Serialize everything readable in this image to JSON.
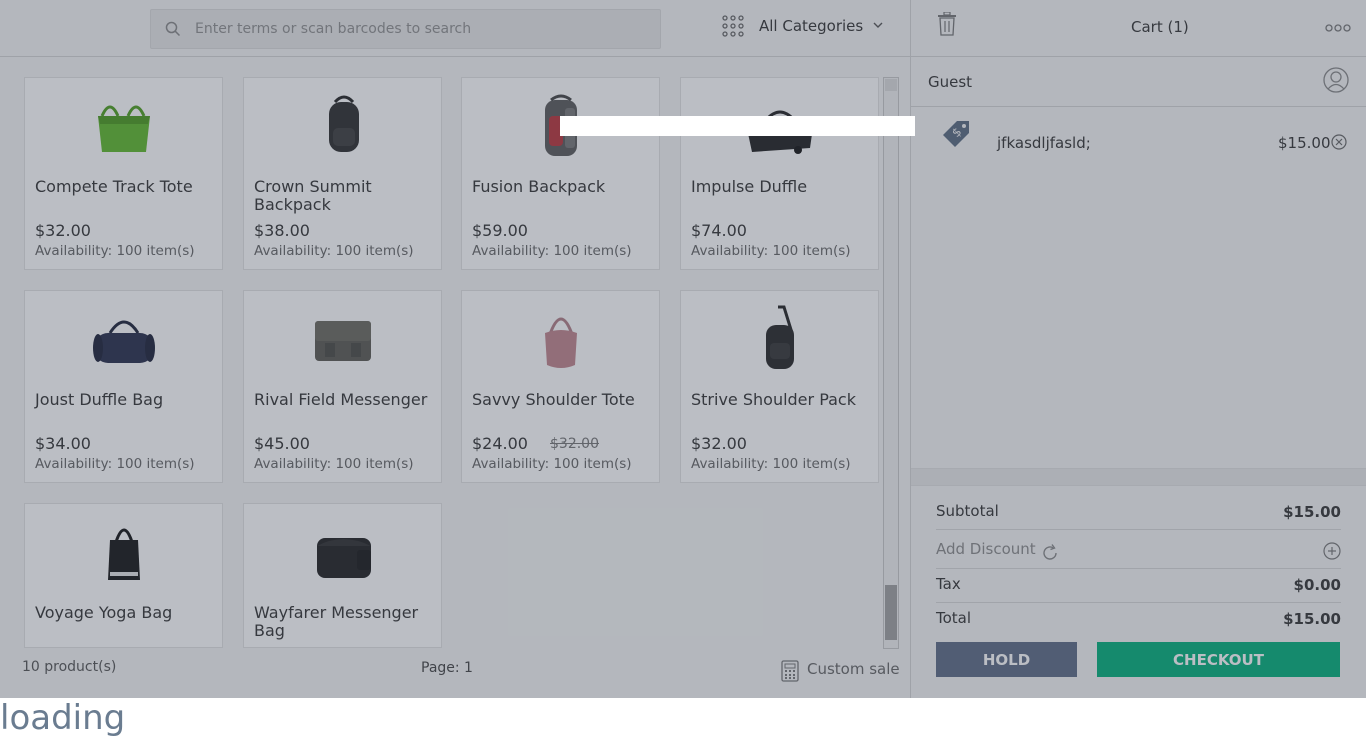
{
  "search": {
    "placeholder": "Enter terms or scan barcodes to search"
  },
  "category": {
    "selected": "All Categories"
  },
  "products": [
    {
      "name": "Compete Track Tote",
      "price": "$32.00",
      "availability": "Availability: 100 item(s)",
      "image": "green-tote-bag"
    },
    {
      "name": "Crown Summit Backpack",
      "price": "$38.00",
      "availability": "Availability: 100 item(s)",
      "image": "black-backpack"
    },
    {
      "name": "Fusion Backpack",
      "price": "$59.00",
      "availability": "Availability: 100 item(s)",
      "image": "gray-red-backpack"
    },
    {
      "name": "Impulse Duffle",
      "price": "$74.00",
      "availability": "Availability: 100 item(s)",
      "image": "black-duffle"
    },
    {
      "name": "Joust Duffle Bag",
      "price": "$34.00",
      "availability": "Availability: 100 item(s)",
      "image": "navy-duffle"
    },
    {
      "name": "Rival Field Messenger",
      "price": "$45.00",
      "availability": "Availability: 100 item(s)",
      "image": "gray-messenger"
    },
    {
      "name": "Savvy Shoulder Tote",
      "price": "$24.00",
      "old_price": "$32.00",
      "availability": "Availability: 100 item(s)",
      "image": "pink-shoulder-tote"
    },
    {
      "name": "Strive Shoulder Pack",
      "price": "$32.00",
      "availability": "Availability: 100 item(s)",
      "image": "black-sling-pack"
    },
    {
      "name": "Voyage Yoga Bag",
      "price": "",
      "availability": "",
      "image": "black-yoga-bag"
    },
    {
      "name": "Wayfarer Messenger Bag",
      "price": "",
      "availability": "",
      "image": "black-messenger"
    }
  ],
  "footer": {
    "count": "10 product(s)",
    "page": "Page: 1",
    "custom_sale": "Custom sale"
  },
  "cart": {
    "title": "Cart (1)",
    "customer": "Guest",
    "items": [
      {
        "name": "jfkasdljfasld;",
        "price": "$15.00"
      }
    ],
    "subtotal_label": "Subtotal",
    "subtotal": "$15.00",
    "discount_label": "Add Discount",
    "tax_label": "Tax",
    "tax": "$0.00",
    "total_label": "Total",
    "total": "$15.00",
    "hold_label": "HOLD",
    "checkout_label": "CHECKOUT"
  },
  "loading_text": "loading",
  "colors": {
    "checkout": "#00b07a",
    "hold": "#5d6b85"
  }
}
